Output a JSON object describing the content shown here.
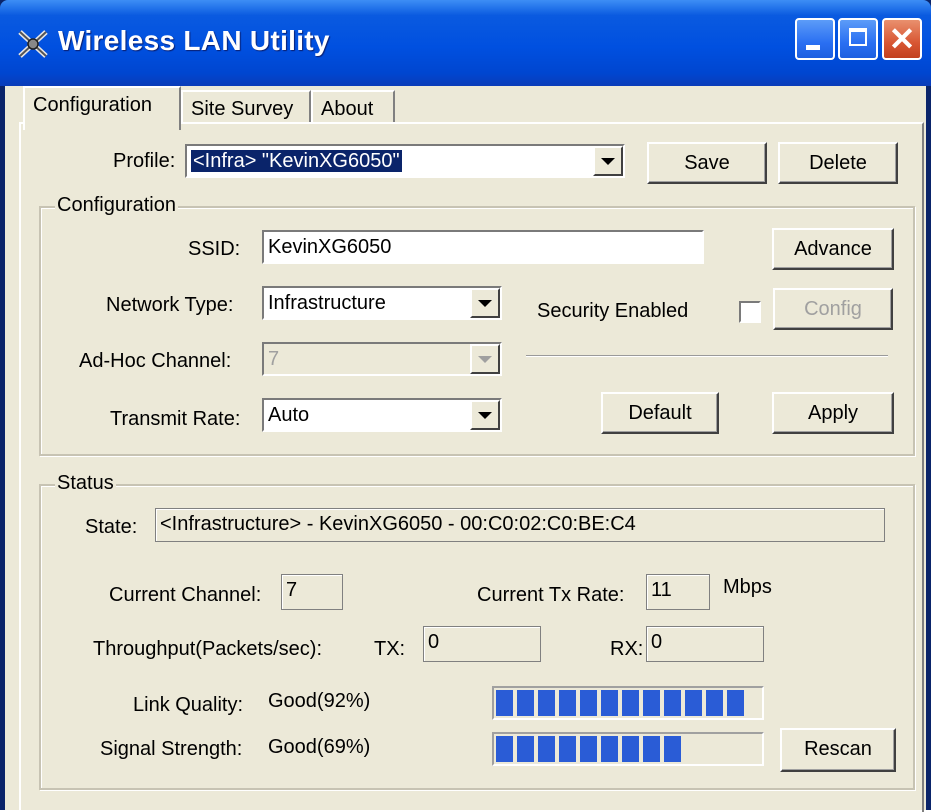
{
  "window": {
    "title": "Wireless LAN Utility"
  },
  "tabs": [
    {
      "label": "Configuration"
    },
    {
      "label": "Site Survey"
    },
    {
      "label": "About"
    }
  ],
  "profile": {
    "label": "Profile:",
    "value": "<Infra> \"KevinXG6050\"",
    "save_label": "Save",
    "delete_label": "Delete"
  },
  "config": {
    "group_title": "Configuration",
    "ssid_label": "SSID:",
    "ssid_value": "KevinXG6050",
    "advance_label": "Advance",
    "network_type_label": "Network Type:",
    "network_type_value": "Infrastructure",
    "security_label": "Security Enabled",
    "security_checked": false,
    "config_label": "Config",
    "adhoc_label": "Ad-Hoc Channel:",
    "adhoc_value": "7",
    "transmit_label": "Transmit Rate:",
    "transmit_value": "Auto",
    "default_label": "Default",
    "apply_label": "Apply"
  },
  "status": {
    "group_title": "Status",
    "state_label": "State:",
    "state_value": "<Infrastructure> - KevinXG6050 - 00:C0:02:C0:BE:C4",
    "channel_label": "Current Channel:",
    "channel_value": "7",
    "tx_rate_label": "Current Tx Rate:",
    "tx_rate_value": "11",
    "tx_rate_unit": "Mbps",
    "throughput_label": "Throughput(Packets/sec):",
    "tx_label": "TX:",
    "tx_value": "0",
    "rx_label": "RX:",
    "rx_value": "0",
    "link_quality_label": "Link Quality:",
    "link_quality_value": "Good(92%)",
    "link_quality_segments": 12,
    "signal_label": "Signal Strength:",
    "signal_value": "Good(69%)",
    "signal_segments": 9,
    "rescan_label": "Rescan"
  }
}
